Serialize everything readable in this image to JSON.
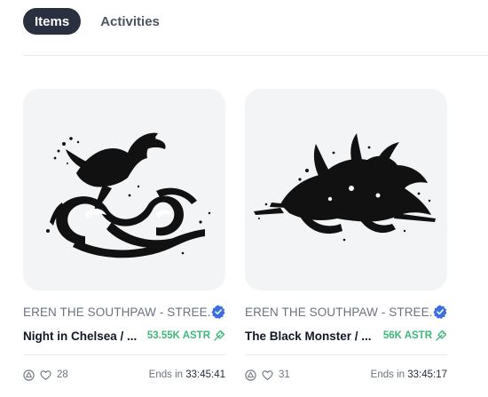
{
  "tabs": [
    {
      "label": "Items",
      "active": true
    },
    {
      "label": "Activities",
      "active": false
    }
  ],
  "colors": {
    "accent_dark": "#2b3040",
    "price_green": "#3fb67a",
    "verified_blue": "#3b6fe0"
  },
  "cards": [
    {
      "collection": "EREN THE SOUTHPAW - STREE...",
      "verified_icon": "verified-badge-icon",
      "title": "Night in Chelsea / ...",
      "price": "53.55K ASTR",
      "price_icon": "tag-icon",
      "likes": "28",
      "ends_label": "Ends in",
      "ends_time": "33:45:41"
    },
    {
      "collection": "EREN THE SOUTHPAW - STREE...",
      "verified_icon": "verified-badge-icon",
      "title": "The Black Monster / ...",
      "price": "56K ASTR",
      "price_icon": "tag-icon",
      "likes": "31",
      "ends_label": "Ends in",
      "ends_time": "33:45:17"
    }
  ]
}
